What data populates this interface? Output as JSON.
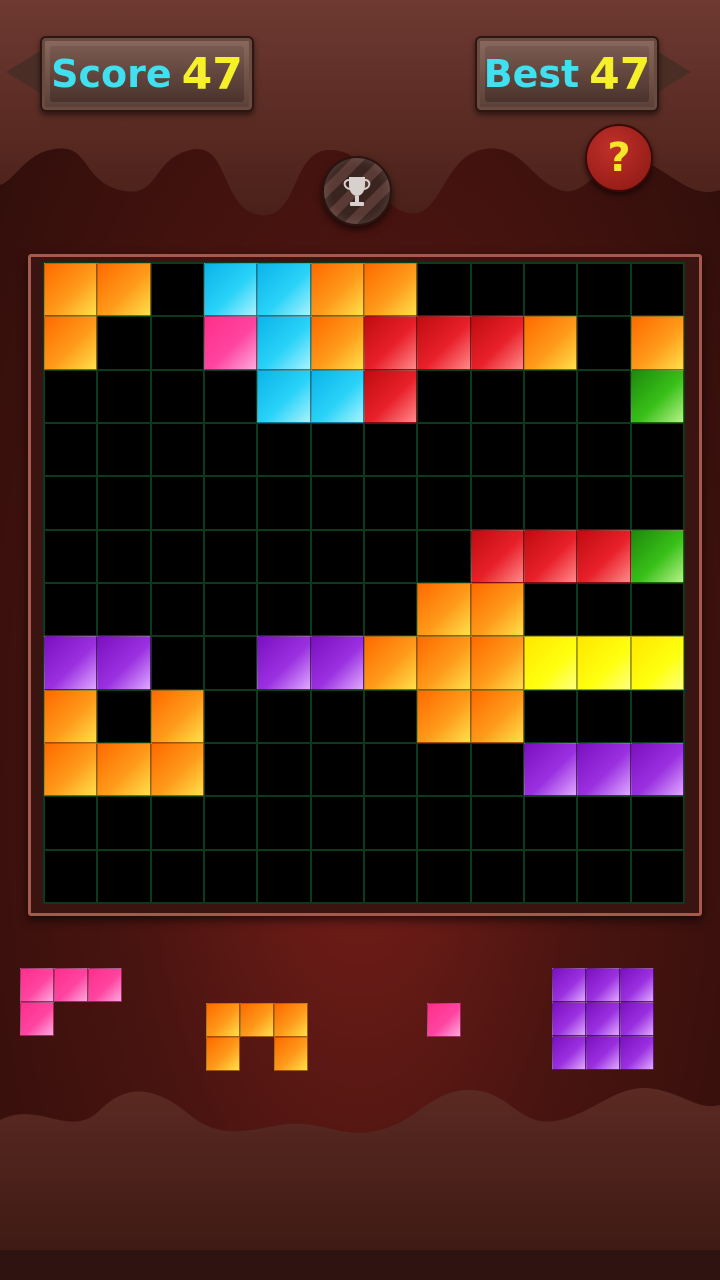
{
  "header": {
    "score_label": "Score",
    "score_value": "47",
    "best_label": "Best",
    "best_value": "47",
    "help_symbol": "?",
    "trophy_icon": "trophy-icon"
  },
  "colors": {
    "O": "#ff9a1a",
    "C": "#28d2f8",
    "P": "#ff44a0",
    "R": "#e8202a",
    "G": "#38c018",
    "V": "#9a30e0",
    "Y": "#ffff10"
  },
  "board": {
    "rows": [
      "OO.CCOO.....",
      "O..PCORRRO.O",
      "....CCR....G",
      "............",
      "............",
      "........RRRG",
      ".......OO...",
      "VV..VVOOOYYY",
      "O.O....OO...",
      "OOO......VVV",
      "............",
      "............"
    ]
  },
  "pieces": [
    {
      "color": "P",
      "shape": [
        "XXX",
        "X.."
      ]
    },
    {
      "color": "O",
      "shape": [
        "XXX",
        "X.X"
      ]
    },
    {
      "color": "P",
      "shape": [
        "X"
      ]
    },
    {
      "color": "V",
      "shape": [
        "XXX",
        "XXX",
        "XXX"
      ]
    }
  ]
}
